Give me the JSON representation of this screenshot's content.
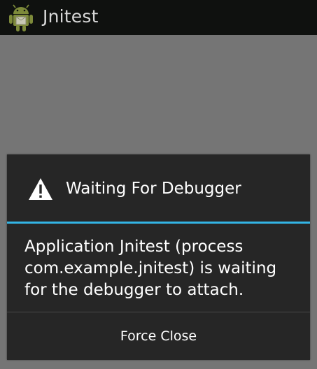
{
  "actionbar": {
    "app_icon": "android-robot-icon",
    "title": "Jnitest"
  },
  "dialog": {
    "icon": "warning-icon",
    "title": "Waiting For Debugger",
    "message": "Application Jnitest (process com.example.jnitest) is waiting for the debugger to attach.",
    "button_label": "Force Close"
  },
  "colors": {
    "actionbar_bg": "#0f110f",
    "content_bg": "#757575",
    "dialog_bg": "#262626",
    "accent_divider": "#33b5e5"
  }
}
